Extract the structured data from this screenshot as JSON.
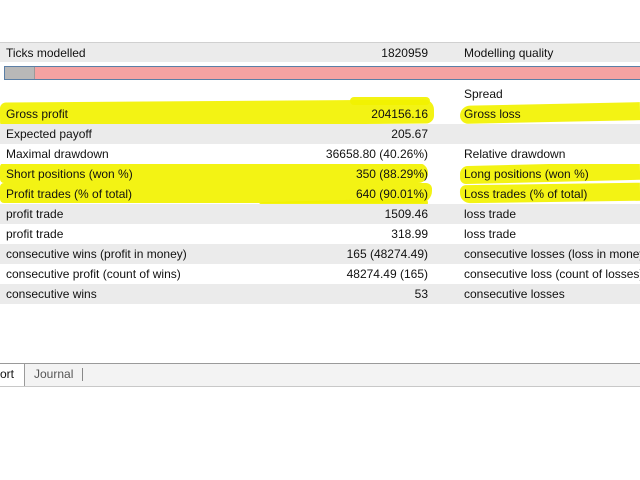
{
  "report": {
    "modelling": {
      "ticks_label": "Ticks modelled",
      "ticks_value": "1820959",
      "quality_label": "Modelling quality",
      "quality_fill_fraction": 0.045
    },
    "spread_label": "Spread",
    "rows": [
      {
        "left_label": "Gross profit",
        "left_value": "204156.16",
        "right_label": "Gross loss"
      },
      {
        "left_label": "Expected payoff",
        "left_value": "205.67",
        "right_label": ""
      },
      {
        "left_label": "Maximal drawdown",
        "left_value": "36658.80 (40.26%)",
        "right_label": "Relative drawdown"
      },
      {
        "left_label": "Short positions (won %)",
        "left_value": "350 (88.29%)",
        "right_label": "Long positions (won %)"
      },
      {
        "left_label": "Profit trades (% of total)",
        "left_value": "640 (90.01%)",
        "right_label": "Loss trades (% of total)"
      },
      {
        "left_label": "profit trade",
        "left_value": "1509.46",
        "right_label": "loss trade"
      },
      {
        "left_label": "profit trade",
        "left_value": "318.99",
        "right_label": "loss trade"
      },
      {
        "left_label": "consecutive wins (profit in money)",
        "left_value": "165 (48274.49)",
        "right_label": "consecutive losses (loss in money"
      },
      {
        "left_label": "consecutive profit (count of wins)",
        "left_value": "48274.49 (165)",
        "right_label": "consecutive loss (count of losses)"
      },
      {
        "left_label": "consecutive wins",
        "left_value": "53",
        "right_label": "consecutive losses"
      }
    ]
  },
  "tabs": {
    "report": "ort",
    "journal": "Journal"
  },
  "colors": {
    "highlight": "#f2f200",
    "progress_remaining": "#f5a2a2",
    "progress_fill": "#b8b8b8"
  }
}
